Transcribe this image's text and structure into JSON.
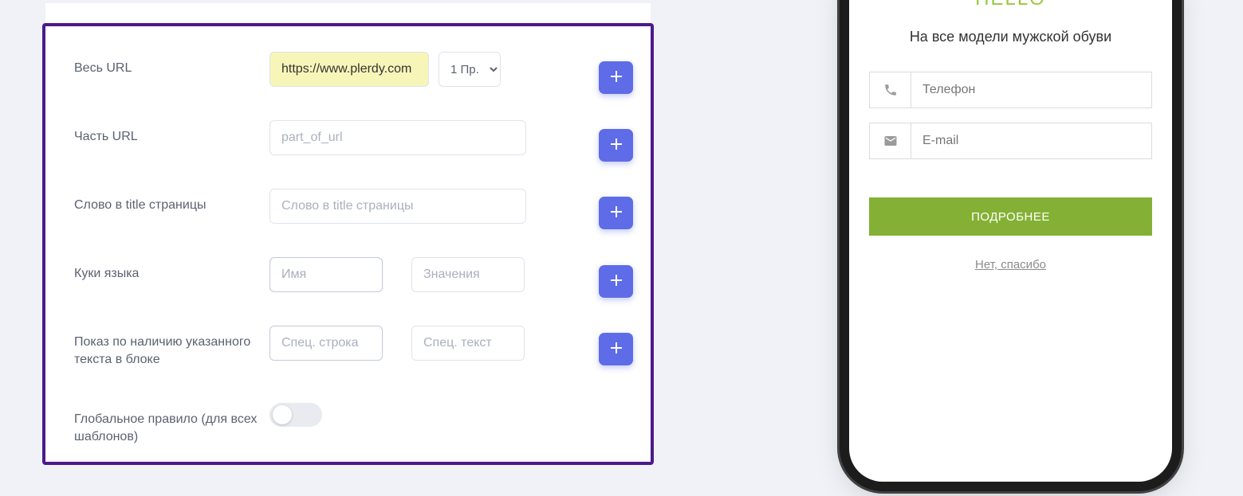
{
  "form": {
    "url": {
      "label": "Весь URL",
      "value": "https://www.plerdy.com",
      "select_option": "1 Пр."
    },
    "part_url": {
      "label": "Часть URL",
      "placeholder": "part_of_url"
    },
    "title_word": {
      "label": "Слово в title страницы",
      "placeholder": "Слово в title страницы"
    },
    "cookie": {
      "label": "Куки языка",
      "name_placeholder": "Имя",
      "value_placeholder": "Значения"
    },
    "text_block": {
      "label": "Показ по наличию указанного текста в блоке",
      "row_placeholder": "Спец. строка",
      "text_placeholder": "Спец. текст"
    },
    "global_rule": {
      "label": "Глобальное правило (для всех шаблонов)"
    }
  },
  "phone": {
    "hello": "HELLO",
    "subtitle": "На все модели мужской обуви",
    "phone_placeholder": "Телефон",
    "email_placeholder": "E-mail",
    "button": "ПОДРОБНЕЕ",
    "no_thanks": "Нет, спасибо"
  }
}
